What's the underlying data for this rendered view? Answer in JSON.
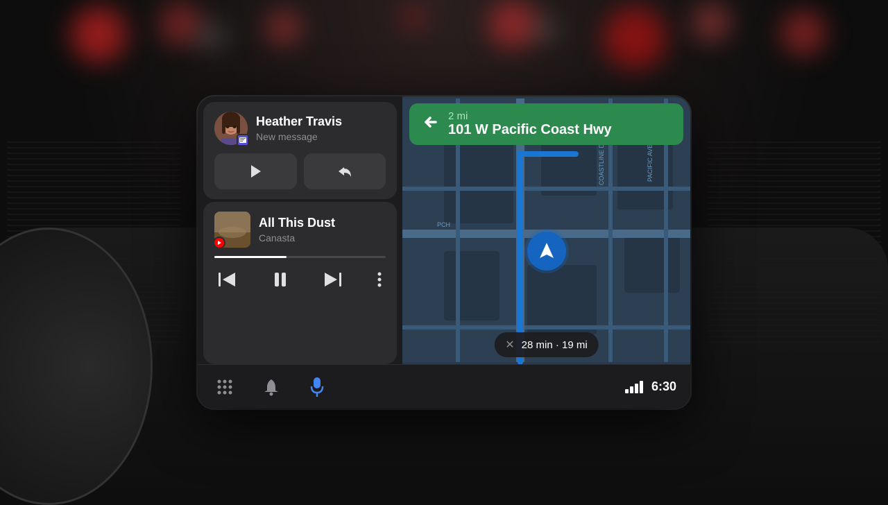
{
  "dashboard": {
    "background_color": "#0d0d0d"
  },
  "screen": {
    "message_card": {
      "contact_name": "Heather Travis",
      "message_label": "New message",
      "play_btn_label": "Play",
      "reply_btn_label": "Reply"
    },
    "music_card": {
      "track_title": "All This Dust",
      "track_artist": "Canasta",
      "progress_percent": 42,
      "prev_btn_label": "Previous",
      "pause_btn_label": "Pause",
      "next_btn_label": "Next",
      "more_btn_label": "More options"
    },
    "navigation": {
      "turn_direction": "left",
      "distance": "2 mi",
      "street_name": "101 W Pacific Coast Hwy",
      "eta_time": "28 min",
      "eta_distance": "19 mi"
    },
    "bottom_bar": {
      "grid_btn_label": "Apps",
      "bell_btn_label": "Notifications",
      "mic_btn_label": "Voice",
      "time": "6:30"
    }
  }
}
